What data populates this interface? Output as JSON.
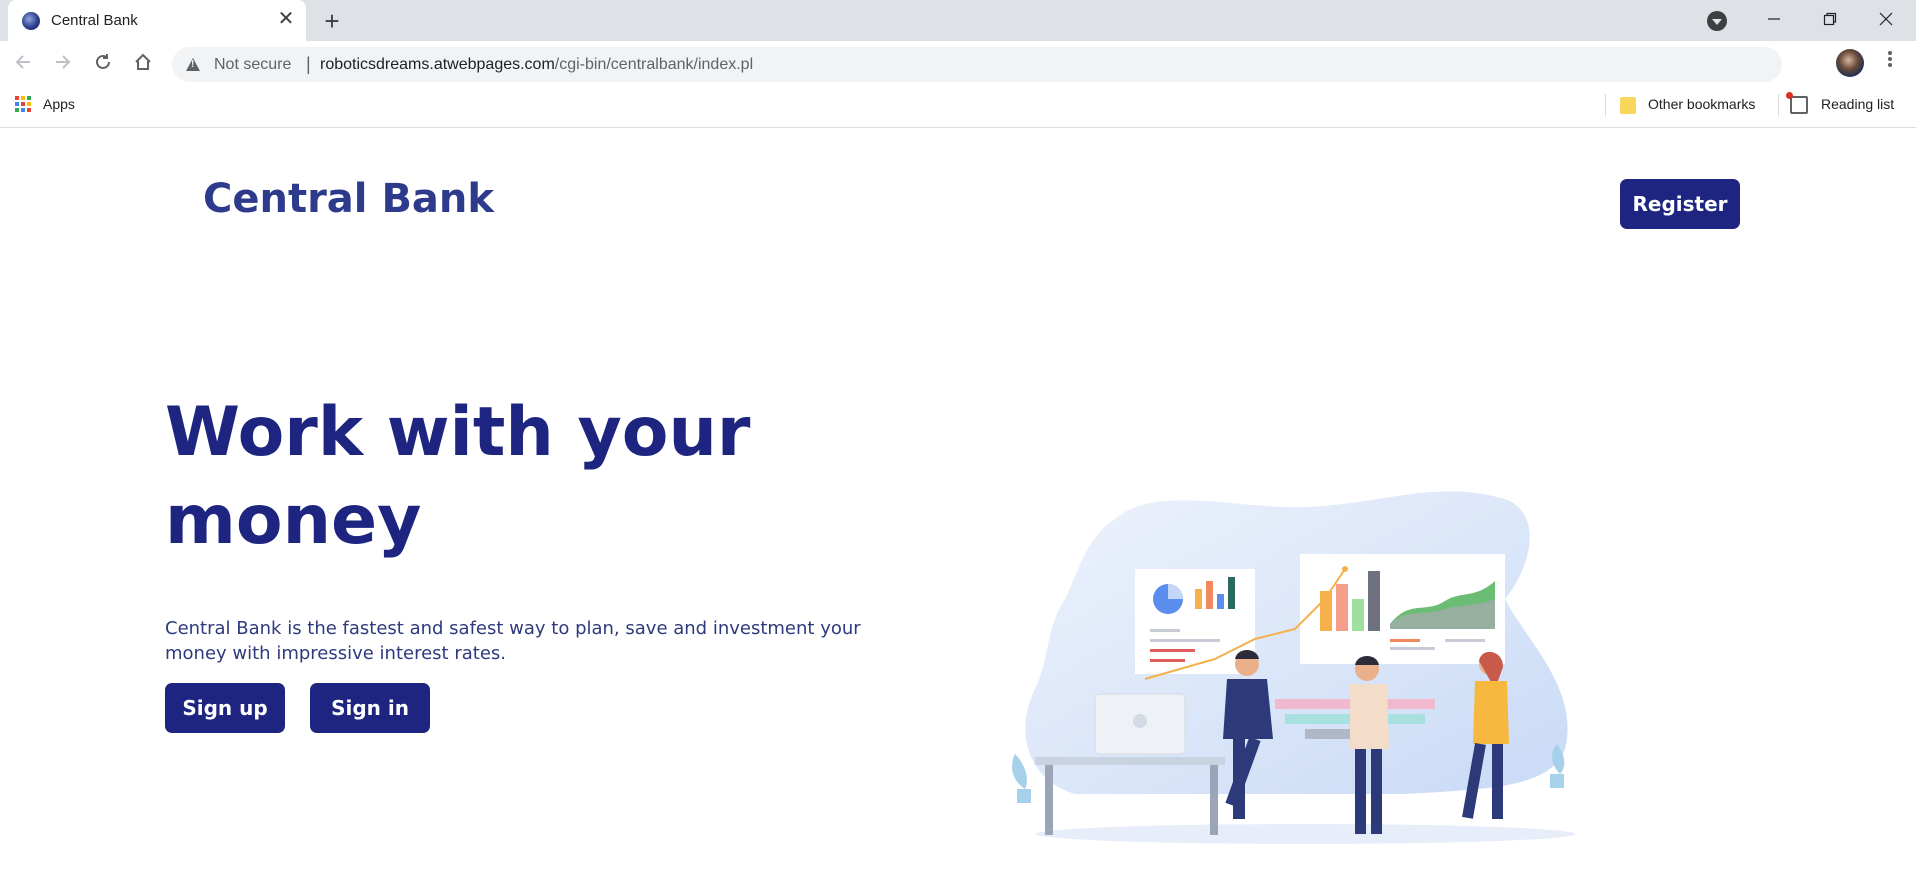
{
  "browser": {
    "tab_title": "Central Bank",
    "close_glyph": "✕",
    "newtab_glyph": "+",
    "security_label": "Not secure",
    "separator": "|",
    "url_host": "roboticsdreams.atwebpages.com",
    "url_path": "/cgi-bin/centralbank/index.pl",
    "bookmarks": {
      "apps_label": "Apps",
      "other_label": "Other bookmarks",
      "reading_label": "Reading list"
    }
  },
  "header": {
    "brand": "Central Bank",
    "register_label": "Register"
  },
  "hero": {
    "title_line1": "Work with your",
    "title_line2": "money",
    "description": "Central Bank is the fastest and safest way to plan, save and investment your money with impressive interest rates.",
    "signup_label": "Sign up",
    "signin_label": "Sign in"
  },
  "colors": {
    "primary": "#1d2580",
    "brand_text": "#2e3a8c",
    "chrome_bg": "#dee1e6",
    "omnibox_bg": "#f1f3f4"
  }
}
